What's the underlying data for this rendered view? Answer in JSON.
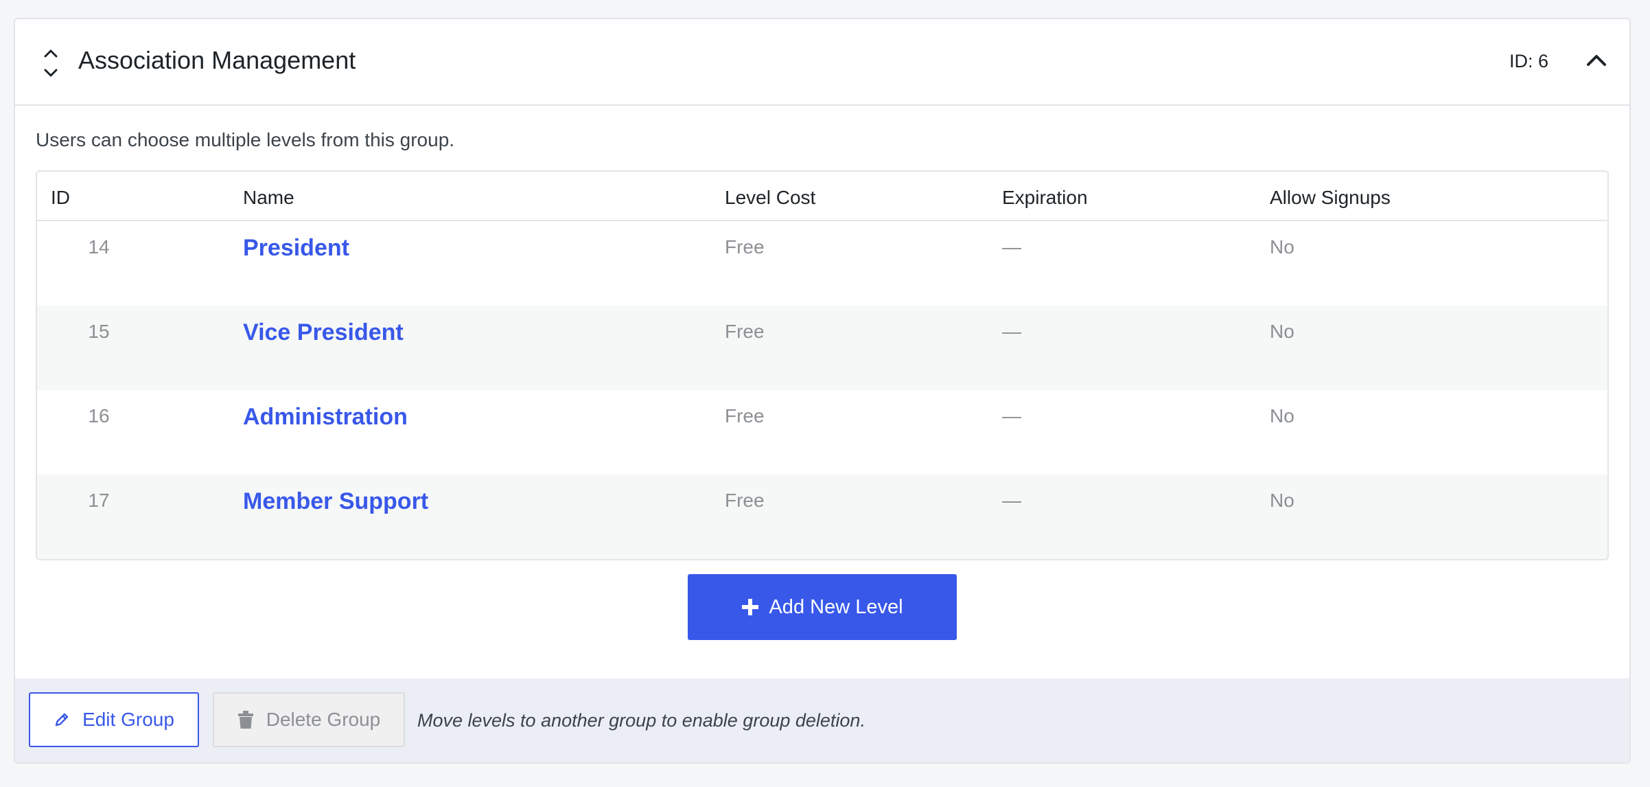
{
  "group": {
    "title": "Association Management",
    "id_label": "ID: 6",
    "description": "Users can choose multiple levels from this group."
  },
  "table": {
    "headers": [
      "ID",
      "Name",
      "Level Cost",
      "Expiration",
      "Allow Signups"
    ],
    "rows": [
      {
        "id": "14",
        "name": "President",
        "cost": "Free",
        "expiration": "—",
        "signups": "No"
      },
      {
        "id": "15",
        "name": "Vice President",
        "cost": "Free",
        "expiration": "—",
        "signups": "No"
      },
      {
        "id": "16",
        "name": "Administration",
        "cost": "Free",
        "expiration": "—",
        "signups": "No"
      },
      {
        "id": "17",
        "name": "Member Support",
        "cost": "Free",
        "expiration": "—",
        "signups": "No"
      }
    ]
  },
  "actions": {
    "add_level": "Add New Level",
    "edit_group": "Edit Group",
    "delete_group": "Delete Group",
    "delete_note": "Move levels to another group to enable group deletion."
  },
  "colors": {
    "accent": "#3858e9",
    "row_alt": "#f6f7f7",
    "footer_bg": "#eceef5"
  },
  "icons": {
    "sort": "sort-up-down-icon",
    "collapse": "chevron-up-icon",
    "add": "plus-icon",
    "edit": "pencil-icon",
    "delete": "trash-icon"
  }
}
